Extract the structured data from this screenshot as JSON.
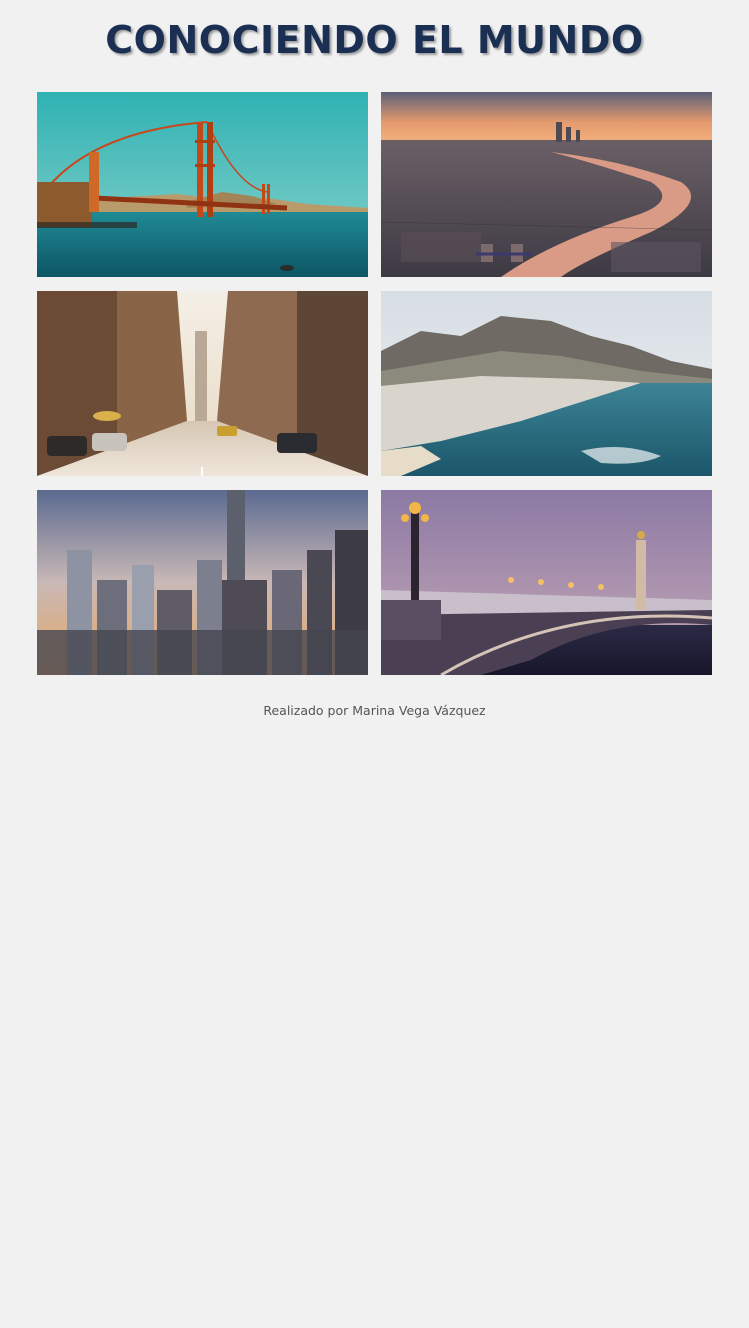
{
  "header": {
    "title": "CONOCIENDO EL MUNDO"
  },
  "gallery": {
    "photos": [
      {
        "subject": "golden-gate-bridge"
      },
      {
        "subject": "london-thames-aerial"
      },
      {
        "subject": "new-york-street"
      },
      {
        "subject": "cape-town-coast"
      },
      {
        "subject": "beijing-skyline"
      },
      {
        "subject": "paris-pont-alexandre-iii"
      }
    ]
  },
  "footer": {
    "credit": "Realizado por Marina Vega Vázquez"
  },
  "colors": {
    "background": "#f1f1f1",
    "title": "#1b2f52",
    "credit_text": "#555555"
  }
}
